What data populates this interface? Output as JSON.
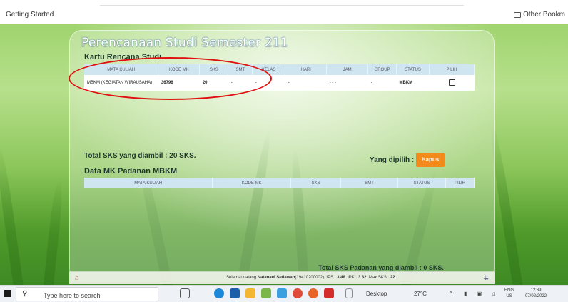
{
  "browser": {
    "bookmark_left": "Getting Started",
    "bookmark_right": "Other Bookm"
  },
  "page": {
    "title": "Perencanaan Studi Semester 211",
    "krs": {
      "section_title": "Kartu Rencana Studi",
      "columns": [
        "MATA KULIAH",
        "KODE MK",
        "SKS",
        "SMT",
        "KELAS",
        "HARI",
        "JAM",
        "GROUP",
        "STATUS",
        "PILIH"
      ],
      "rows": [
        {
          "mata_kuliah": "MBKM (KEGIATAN WIRAUSAHA)",
          "kode_mk": "36796",
          "sks": "20",
          "smt": "-",
          "kelas": "-",
          "hari": "-",
          "jam": "- - -",
          "group": "-",
          "status": "MBKM",
          "pilih": false
        }
      ]
    },
    "total_sks": "Total SKS yang diambil : 20 SKS.",
    "dipilih_label": "Yang dipilih :",
    "hapus_label": "Hapus",
    "padanan": {
      "section_title": "Data MK Padanan MBKM",
      "columns": [
        "MATA KULIAH",
        "KODE MK",
        "SKS",
        "SMT",
        "STATUS",
        "PILIH"
      ]
    },
    "total_padanan": "Total SKS Padanan yang diambil : 0 SKS."
  },
  "statusbar": {
    "welcome_prefix": "Selamat datang ",
    "user_name": "Natanael Setiawan",
    "welcome_suffix": "(19410200002). IPS : ",
    "ips": "3.48",
    "ipk_label": ". IPK : ",
    "ipk": "3.32",
    "max_label": ". Max SKS : ",
    "max_sks": "22",
    "end": "."
  },
  "taskbar": {
    "search_placeholder": "Type here to search",
    "desktop_label": "Desktop",
    "temperature": "27°C",
    "lang_line1": "ENG",
    "lang_line2": "US",
    "time": "12:39",
    "date": "07/02/2022"
  },
  "colors": {
    "hapus_button": "#f38a1c",
    "highlight": "#e01010",
    "table_header": "#cfe6f0"
  }
}
